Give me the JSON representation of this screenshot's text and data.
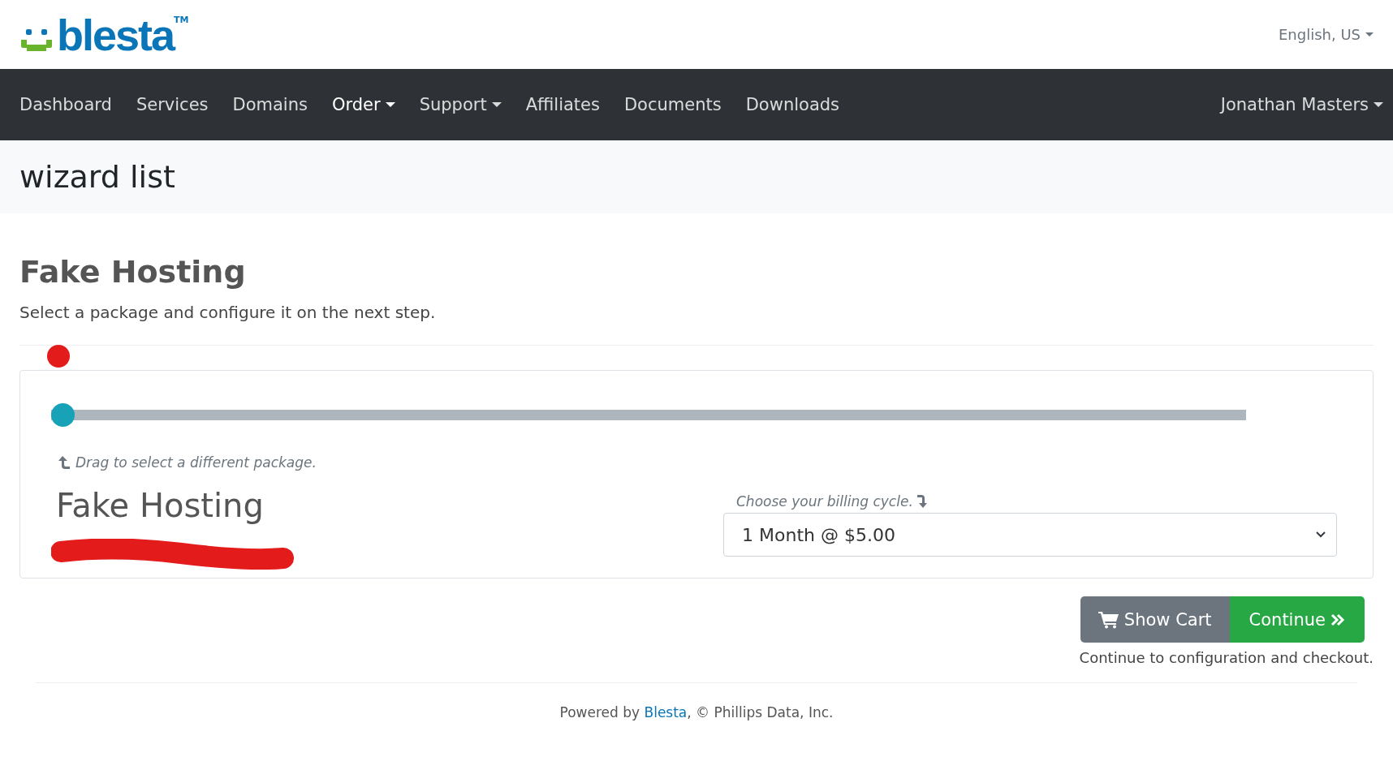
{
  "logo": {
    "text": "blesta",
    "mark": "TM"
  },
  "language": {
    "label": "English, US"
  },
  "nav": {
    "items": [
      {
        "label": "Dashboard",
        "dropdown": false,
        "selected": false
      },
      {
        "label": "Services",
        "dropdown": false,
        "selected": false
      },
      {
        "label": "Domains",
        "dropdown": false,
        "selected": false
      },
      {
        "label": "Order",
        "dropdown": true,
        "selected": true
      },
      {
        "label": "Support",
        "dropdown": true,
        "selected": false
      },
      {
        "label": "Affiliates",
        "dropdown": false,
        "selected": false
      },
      {
        "label": "Documents",
        "dropdown": false,
        "selected": false
      },
      {
        "label": "Downloads",
        "dropdown": false,
        "selected": false
      }
    ],
    "user": {
      "label": "Jonathan Masters"
    }
  },
  "page_title": "wizard list",
  "group": {
    "title": "Fake Hosting",
    "description": "Select a package and configure it on the next step."
  },
  "package_slider": {
    "level": 0,
    "hint": "Drag to select a different package."
  },
  "package": {
    "name": "Fake Hosting"
  },
  "billing": {
    "label": "Choose your billing cycle.",
    "value": "1 Month @ $5.00"
  },
  "buttons": {
    "show_cart": "Show Cart",
    "continue": "Continue"
  },
  "caption": "Continue to configuration and checkout.",
  "footer": {
    "prefix": "Powered by ",
    "link": "Blesta",
    "suffix": ", © Phillips Data, Inc."
  }
}
